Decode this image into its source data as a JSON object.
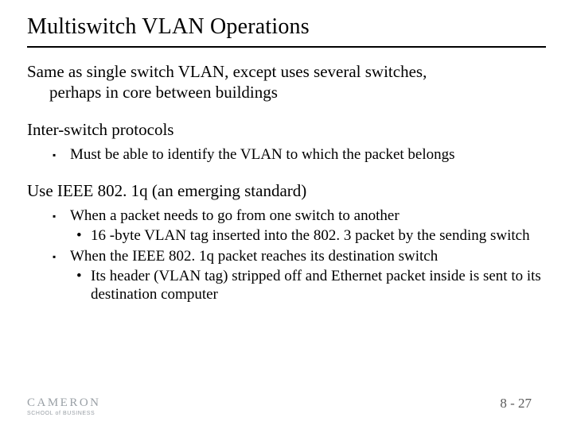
{
  "title": "Multiswitch VLAN Operations",
  "para1_line1": "Same as single switch VLAN, except uses several switches,",
  "para1_line2": "perhaps in core between buildings",
  "para2": "Inter-switch protocols",
  "para2_bullets": [
    "Must be able to identify the VLAN to which the packet belongs"
  ],
  "para3": "Use IEEE 802. 1q (an emerging standard)",
  "para3_bullets": [
    {
      "text": "When a packet needs to go from one switch to another",
      "sub": [
        "16 -byte VLAN tag inserted into the 802. 3 packet by the sending switch"
      ]
    },
    {
      "text": "When the IEEE 802. 1q packet reaches its destination switch",
      "sub": [
        "Its header (VLAN tag) stripped off and Ethernet packet inside is sent to its destination computer"
      ]
    }
  ],
  "logo_main": "CAMERON",
  "logo_sub": "SCHOOL of BUSINESS",
  "pageno": "8 - 27"
}
